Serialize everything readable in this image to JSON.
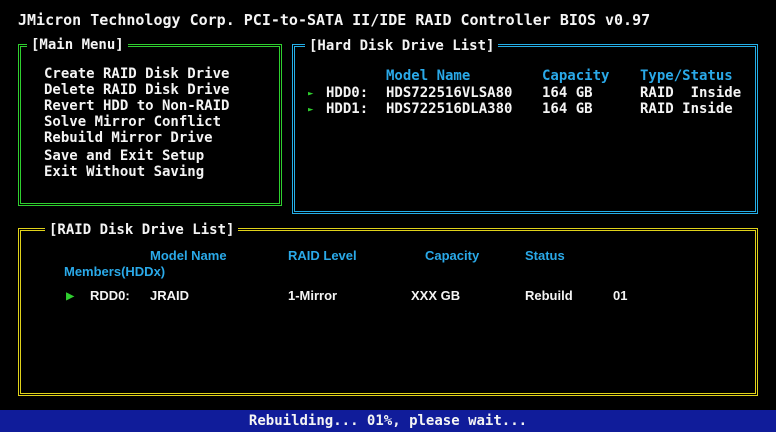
{
  "title": "JMicron Technology Corp. PCI-to-SATA II/IDE RAID Controller BIOS v0.97",
  "main_menu": {
    "title": "[Main Menu]",
    "items": [
      "Create RAID Disk Drive",
      "Delete RAID Disk Drive",
      "Revert HDD to Non-RAID",
      "Solve Mirror Conflict",
      "Rebuild Mirror Drive",
      "Save and Exit Setup",
      "Exit Without Saving"
    ]
  },
  "hdd_list": {
    "title": "[Hard Disk Drive List]",
    "headers": {
      "model": "Model Name",
      "capacity": "Capacity",
      "type": "Type/Status"
    },
    "rows": [
      {
        "id": "HDD0:",
        "model": "HDS722516VLSA80",
        "capacity": "164 GB",
        "type": "RAID  Inside"
      },
      {
        "id": "HDD1:",
        "model": "HDS722516DLA380",
        "capacity": "164 GB",
        "type": "RAID Inside"
      }
    ]
  },
  "raid_list": {
    "title": "[RAID Disk Drive List]",
    "headers": {
      "model": "Model Name",
      "members": "Members(HDDx)",
      "level": "RAID Level",
      "capacity": "Capacity",
      "status": "Status"
    },
    "rows": [
      {
        "id": "RDD0:",
        "model": "JRAID",
        "level": "1-Mirror",
        "capacity": "XXX GB",
        "status": "Rebuild",
        "members": "01"
      }
    ]
  },
  "status_bar": "Rebuilding... 01%, please wait...",
  "colors": {
    "green": "#2fcf2f",
    "cyan": "#24aee6",
    "yellow": "#e0d21a",
    "status_bg": "#101c9a"
  }
}
